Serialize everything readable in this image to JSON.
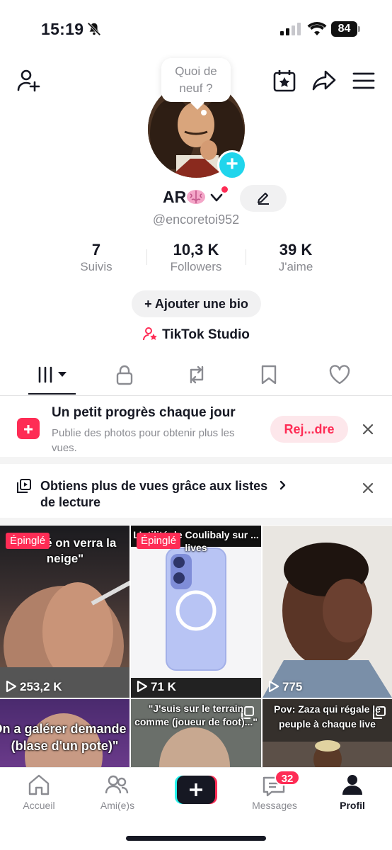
{
  "status_bar": {
    "time": "15:19",
    "battery": "84"
  },
  "bubble": {
    "text_line1": "Quoi de",
    "text_line2": "neuf ?"
  },
  "profile": {
    "display_name": "AR",
    "username": "@encoretoi952",
    "stats": [
      {
        "value": "7",
        "label": "Suivis"
      },
      {
        "value": "10,3 K",
        "label": "Followers"
      },
      {
        "value": "39 K",
        "label": "J'aime"
      }
    ],
    "bio_button": "+ Ajouter une bio",
    "studio_link": "TikTok Studio"
  },
  "promo": {
    "title": "Un petit progrès chaque jour",
    "subtitle": "Publie des photos pour obtenir plus les vues.",
    "button": "Rej...dre"
  },
  "playlist_tip": {
    "text": "Obtiens plus de vues grâce aux listes de lecture"
  },
  "videos": [
    {
      "caption": "W...été on verra la neige\"",
      "pinned": "Épinglé",
      "views": "253,2 K"
    },
    {
      "caption": "L'utilité de Coulibaly sur ... lives",
      "pinned": "Épinglé",
      "views": "71 K"
    },
    {
      "caption": "",
      "pinned": "",
      "views": "775"
    },
    {
      "caption": "On a galérer demande à (blase d'un pote)\"",
      "pinned": "",
      "views": ""
    },
    {
      "caption": "\"J'suis sur le terrain comme (joueur de foot)...\"",
      "pinned": "",
      "views": ""
    },
    {
      "caption": "Pov: Zaza qui régale le peuple à chaque live",
      "pinned": "",
      "views": ""
    }
  ],
  "bottom_nav": {
    "home": "Accueil",
    "friends": "Ami(e)s",
    "messages": "Messages",
    "messages_badge": "32",
    "profile": "Profil"
  },
  "colors": {
    "accent": "#fe2c55",
    "cyan": "#20d5ec",
    "text": "#161823",
    "muted": "#8a8b91"
  }
}
